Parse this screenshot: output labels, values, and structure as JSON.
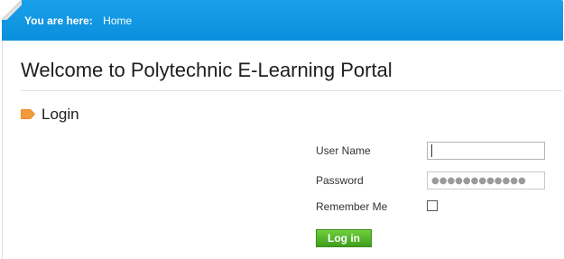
{
  "breadcrumb": {
    "label": "You are here:",
    "home": "Home"
  },
  "page": {
    "title": "Welcome to Polytechnic E-Learning Portal"
  },
  "login_section": {
    "title": "Login",
    "icon": "orange-tag-icon"
  },
  "form": {
    "username_label": "User Name",
    "username_value": "",
    "password_label": "Password",
    "password_value": "●●●●●●●●●●●●",
    "remember_label": "Remember Me",
    "remember_checked": false,
    "submit_label": "Log in"
  },
  "colors": {
    "topbar": "#0a8fdc",
    "accent_orange": "#f08a24",
    "button_green": "#4aac24"
  }
}
